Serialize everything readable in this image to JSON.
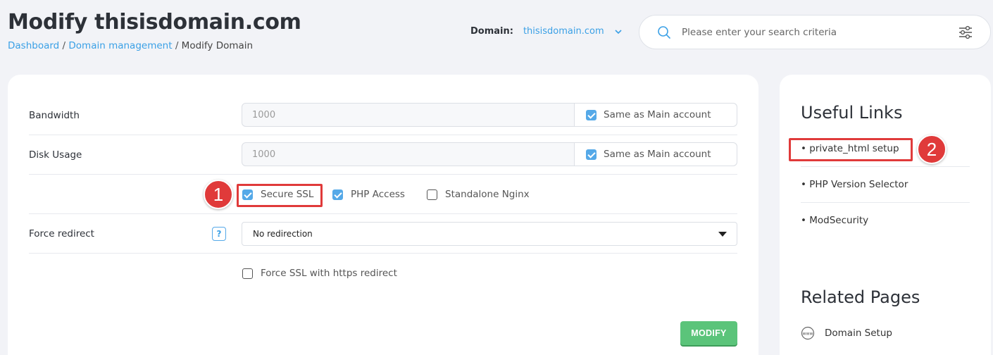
{
  "header": {
    "title": "Modify thisisdomain.com",
    "breadcrumb": {
      "dashboard": "Dashboard",
      "sep1": "/",
      "domain_management": "Domain management",
      "sep2": "/",
      "current": "Modify Domain"
    },
    "domain_label": "Domain:",
    "domain_value": "thisisdomain.com",
    "search_placeholder": "Please enter your search criteria"
  },
  "form": {
    "bandwidth": {
      "label": "Bandwidth",
      "value": "1000",
      "same_as_label": "Same as Main account",
      "same_as_checked": true
    },
    "disk_usage": {
      "label": "Disk Usage",
      "value": "1000",
      "same_as_label": "Same as Main account",
      "same_as_checked": true
    },
    "options": [
      {
        "label": "Secure SSL",
        "checked": true
      },
      {
        "label": "PHP Access",
        "checked": true
      },
      {
        "label": "Standalone Nginx",
        "checked": false
      }
    ],
    "force_redirect": {
      "label": "Force redirect",
      "help": "?",
      "selected": "No redirection"
    },
    "force_ssl": {
      "label": "Force SSL with https redirect",
      "checked": false
    },
    "submit_label": "MODIFY"
  },
  "sidebar": {
    "useful_links_heading": "Useful Links",
    "useful_links": [
      "• private_html setup",
      "• PHP Version Selector",
      "• ModSecurity"
    ],
    "related_heading": "Related Pages",
    "related_pages": [
      "Domain Setup"
    ]
  },
  "annotations": {
    "marker1": "1",
    "marker2": "2",
    "color": "#e03a3a"
  },
  "colors": {
    "accent": "#3aa0e6",
    "button": "#5bc47a",
    "background": "#f2f3f7"
  }
}
